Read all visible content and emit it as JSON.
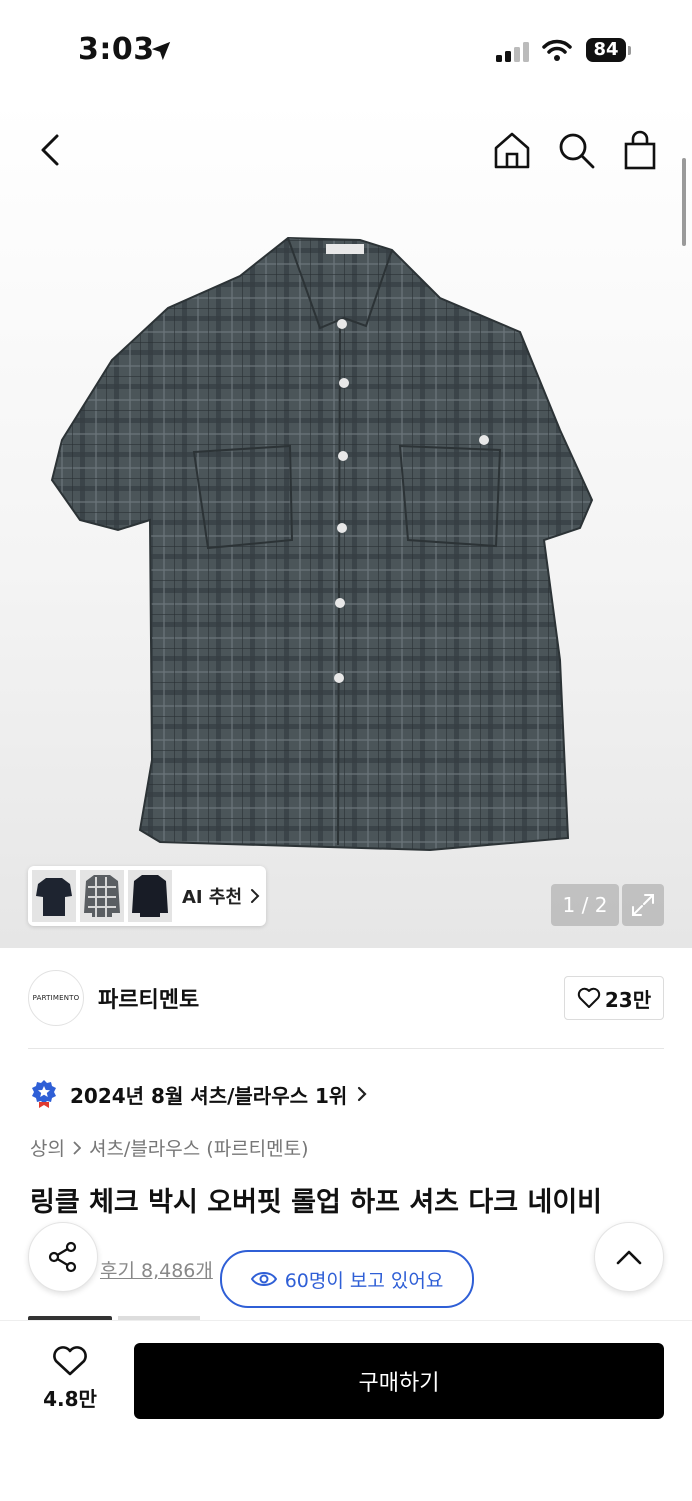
{
  "status_bar": {
    "time": "3:03",
    "battery": "84"
  },
  "nav": {
    "icons": [
      "back-icon",
      "home-icon",
      "search-icon",
      "shopping-bag-icon"
    ]
  },
  "gallery": {
    "pager": "1 / 2",
    "ai_recommend_label": "AI 추천",
    "shirt_label": "PARTIMENTO"
  },
  "brand": {
    "logo_text": "PARTIMENTO",
    "name": "파르티멘토",
    "likes": "23만"
  },
  "ranking": {
    "text": "2024년 8월 셔츠/블라우스 1위"
  },
  "breadcrumb": {
    "level1": "상의",
    "level2": "셔츠/블라우스 (파르티멘토)"
  },
  "product": {
    "title": "링클 체크 박시 오버핏 롤업 하프 셔츠 다크 네이비",
    "review_text": "후기 8,486개"
  },
  "viewing": {
    "text": "60명이 보고 있어요"
  },
  "bottom": {
    "wish_count": "4.8만",
    "buy_label": "구매하기"
  },
  "colors": {
    "accent_blue": "#2f5fd6",
    "buy_button": "#000000",
    "shirt": "#4b5559"
  }
}
